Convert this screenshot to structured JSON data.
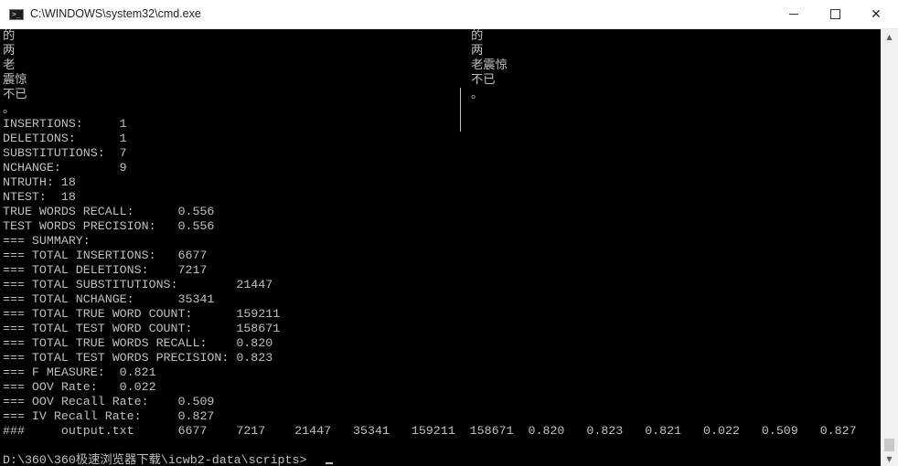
{
  "window": {
    "title": "C:\\WINDOWS\\system32\\cmd.exe",
    "app_icon": "cmd-icon",
    "controls": {
      "minimize": "minimize-icon",
      "maximize": "maximize-icon",
      "close": "✕"
    }
  },
  "console": {
    "left_column": [
      "的",
      "两",
      "老",
      "震惊",
      "不已",
      "。"
    ],
    "right_column": [
      "的",
      "两",
      "老震惊",
      "不已",
      "。"
    ],
    "stats": [
      "INSERTIONS:     1",
      "DELETIONS:      1",
      "SUBSTITUTIONS:  7",
      "NCHANGE:        9",
      "NTRUTH: 18",
      "NTEST:  18",
      "TRUE WORDS RECALL:      0.556",
      "TEST WORDS PRECISION:   0.556",
      "=== SUMMARY:",
      "=== TOTAL INSERTIONS:   6677",
      "=== TOTAL DELETIONS:    7217",
      "=== TOTAL SUBSTITUTIONS:        21447",
      "=== TOTAL NCHANGE:      35341",
      "=== TOTAL TRUE WORD COUNT:      159211",
      "=== TOTAL TEST WORD COUNT:      158671",
      "=== TOTAL TRUE WORDS RECALL:    0.820",
      "=== TOTAL TEST WORDS PRECISION: 0.823",
      "=== F MEASURE:  0.821",
      "=== OOV Rate:   0.022",
      "=== OOV Recall Rate:    0.509",
      "=== IV Recall Rate:     0.827",
      "###     output.txt      6677    7217    21447   35341   159211  158671  0.820   0.823   0.821   0.022   0.509   0.827"
    ],
    "prompt": "D:\\360\\360极速浏览器下载\\icwb2-data\\scripts>"
  },
  "colors": {
    "console_background": "#000000",
    "console_text": "#c0c0c0",
    "titlebar_background": "#ffffff"
  }
}
